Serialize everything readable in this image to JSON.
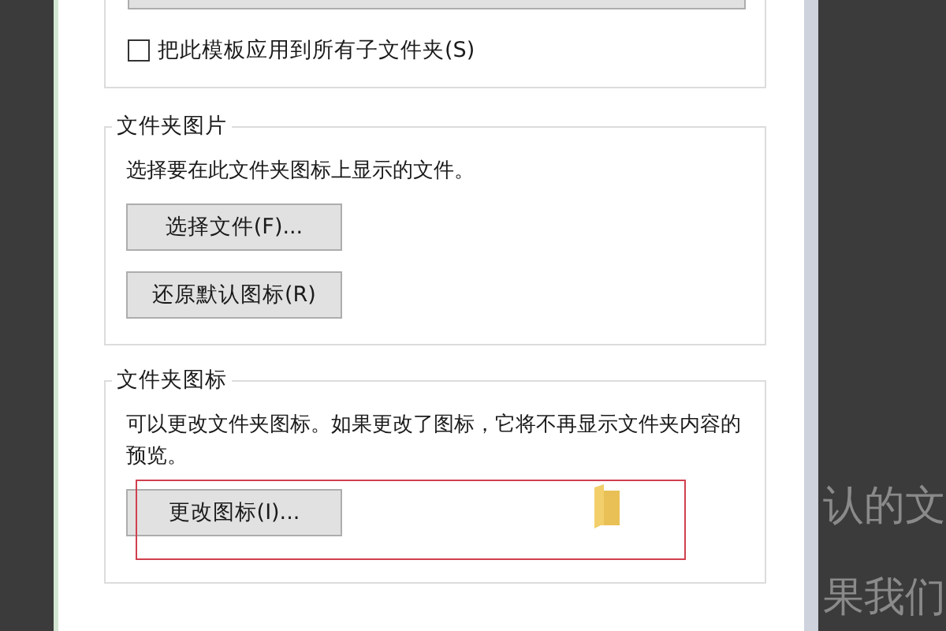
{
  "template": {
    "apply_to_subfolders": {
      "label": "把此模板应用到所有子文件夹(S)",
      "checked": false
    }
  },
  "groups": [
    {
      "title": "文件夹图片",
      "description": "选择要在此文件夹图标上显示的文件。",
      "buttons": [
        "选择文件(F)...",
        "还原默认图标(R)"
      ],
      "highlighted": false
    },
    {
      "title": "文件夹图标",
      "description": "可以更改文件夹图标。如果更改了图标，它将不再显示文件夹内容的预览。",
      "buttons": [
        "更改图标(I)..."
      ],
      "highlighted": true
    }
  ],
  "background_text": [
    "认的文",
    "果我们"
  ]
}
